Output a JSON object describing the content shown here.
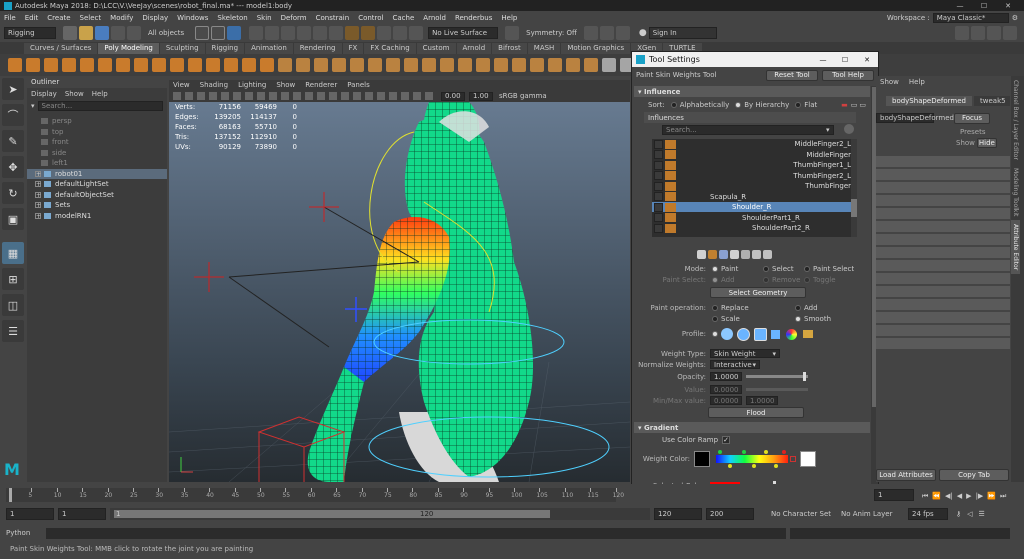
{
  "window": {
    "title": "Autodesk Maya 2018: D:\\LCC\\V.\\VeeJay\\scenes\\robot_final.ma*   ---   model1:body",
    "workspace_label": "Workspace :",
    "workspace_value": "Maya Classic*"
  },
  "menubar": [
    "File",
    "Edit",
    "Create",
    "Select",
    "Modify",
    "Display",
    "Windows",
    "Skeleton",
    "Skin",
    "Deform",
    "Constrain",
    "Control",
    "Cache",
    "Arnold",
    "Renderbus",
    "Help"
  ],
  "statusline": {
    "mode": "Rigging",
    "objects": "All objects",
    "live_surface": "No Live Surface",
    "symmetry": "Symmetry: Off",
    "sign_in": "Sign In"
  },
  "shelf_tabs": [
    "Curves / Surfaces",
    "Poly Modeling",
    "Sculpting",
    "Rigging",
    "Animation",
    "Rendering",
    "FX",
    "FX Caching",
    "Custom",
    "Arnold",
    "Bifrost",
    "MASH",
    "Motion Graphics",
    "XGen",
    "TURTLE"
  ],
  "shelf_active": "Poly Modeling",
  "outliner": {
    "title": "Outliner",
    "menu": [
      "Display",
      "Show",
      "Help"
    ],
    "search_placeholder": "Search...",
    "items": [
      {
        "label": "persp",
        "dim": true
      },
      {
        "label": "top",
        "dim": true
      },
      {
        "label": "front",
        "dim": true
      },
      {
        "label": "side",
        "dim": true
      },
      {
        "label": "left1",
        "dim": true
      },
      {
        "label": "robot01",
        "dim": false,
        "sel": true
      },
      {
        "label": "defaultLightSet",
        "dim": false
      },
      {
        "label": "defaultObjectSet",
        "dim": false
      },
      {
        "label": "Sets",
        "dim": false
      },
      {
        "label": "modelRN1",
        "dim": false
      }
    ]
  },
  "viewport": {
    "menu": [
      "View",
      "Shading",
      "Lighting",
      "Show",
      "Renderer",
      "Panels"
    ],
    "gamma": "sRGB gamma",
    "near": "0.00",
    "far": "1.00",
    "hud": [
      [
        "Verts:",
        "71156",
        "59469",
        "0"
      ],
      [
        "Edges:",
        "139205",
        "114137",
        "0"
      ],
      [
        "Faces:",
        "68163",
        "55710",
        "0"
      ],
      [
        "Tris:",
        "137152",
        "112910",
        "0"
      ],
      [
        "UVs:",
        "90129",
        "73890",
        "0"
      ]
    ]
  },
  "tool_settings": {
    "title": "Tool Settings",
    "tool_name": "Paint Skin Weights Tool",
    "reset": "Reset Tool",
    "help": "Tool Help",
    "influence_header": "Influence",
    "sort_label": "Sort:",
    "sort_options": [
      "Alphabetically",
      "By Hierarchy",
      "Flat"
    ],
    "sort_selected": 1,
    "influences_label": "Influences",
    "search_placeholder": "Search...",
    "influence_list": [
      "MiddleFinger2_L",
      "MiddleFinger",
      "ThumbFinger1_L",
      "ThumbFinger2_L",
      "ThumbFinger",
      "Scapula_R",
      "Shoulder_R",
      "ShoulderPart1_R",
      "ShoulderPart2_R"
    ],
    "influence_selected": 6,
    "mode_label": "Mode:",
    "mode_options": [
      "Paint",
      "Select",
      "Paint Select"
    ],
    "paint_select_label": "Paint Select:",
    "paint_select_options": [
      "Add",
      "Remove",
      "Toggle"
    ],
    "select_geometry": "Select Geometry",
    "paint_op_label": "Paint operation:",
    "paint_ops": [
      "Replace",
      "Add",
      "Scale",
      "Smooth"
    ],
    "paint_op_selected": 3,
    "profile_label": "Profile:",
    "weight_type_label": "Weight Type:",
    "weight_type": "Skin Weight",
    "normalize_label": "Normalize Weights:",
    "normalize": "Interactive",
    "opacity_label": "Opacity:",
    "opacity": "1.0000",
    "opacity_fraction": 0.97,
    "value_label": "Value:",
    "value": "0.0000",
    "minmax_label": "Min/Max value:",
    "min": "0.0000",
    "max": "1.0000",
    "flood": "Flood",
    "gradient_header": "Gradient",
    "use_color_ramp": "Use Color Ramp",
    "weight_color_label": "Weight Color:",
    "selected_color_label": "Selected Color:",
    "selected_color": "#ff0000"
  },
  "attr_editor": {
    "menu": [
      "Show",
      "Help"
    ],
    "tab1": "bodyShapeDeformed",
    "tab2": "tweak5",
    "name_field": "bodyShapeDeformed",
    "focus": "Focus",
    "presets": "Presets",
    "show": "Show",
    "hide": "Hide",
    "load_attr": "Load Attributes",
    "copy_tab": "Copy Tab",
    "side_tabs": [
      "Channel Box / Layer Editor",
      "Modeling Toolkit",
      "Attribute Editor"
    ]
  },
  "timeline": {
    "ticks": [
      "5",
      "10",
      "15",
      "20",
      "25",
      "30",
      "35",
      "40",
      "45",
      "50",
      "55",
      "60",
      "65",
      "70",
      "75",
      "80",
      "85",
      "90",
      "95",
      "100",
      "105",
      "110",
      "115",
      "120"
    ],
    "start": "1",
    "end": "120",
    "range_start": "1",
    "range_in": "1",
    "range_out": "120",
    "anim_end": "120",
    "anim_end2": "200",
    "current": "1",
    "character": "No Character Set",
    "anim_layer": "No Anim Layer",
    "fps": "24 fps"
  },
  "command": {
    "lang": "Python"
  },
  "help_line": "Paint Skin Weights Tool: MMB click to rotate the joint you are painting",
  "logo": "M"
}
